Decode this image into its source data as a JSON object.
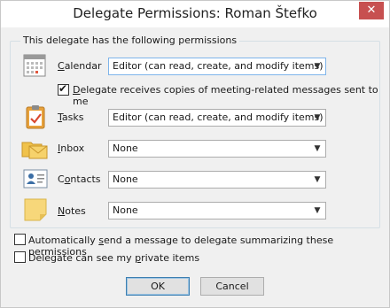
{
  "dialog": {
    "title": "Delegate Permissions: Roman Štefko",
    "close_glyph": "✕"
  },
  "group": {
    "legend": "This delegate has the following permissions"
  },
  "permissions": [
    {
      "label": "Calendar",
      "mnemonic": "C",
      "rest": "alendar",
      "icon": "calendar-icon",
      "value": "Editor (can read, create, and modify items)"
    },
    {
      "label": "Tasks",
      "mnemonic": "T",
      "rest": "asks",
      "icon": "tasks-clipboard-icon",
      "value": "Editor (can read, create, and modify items)"
    },
    {
      "label": "Inbox",
      "mnemonic": "I",
      "rest": "nbox",
      "icon": "inbox-envelope-icon",
      "value": "None"
    },
    {
      "label": "Contacts",
      "mnemonic": "o",
      "pre": "C",
      "rest": "ntacts",
      "icon": "contact-card-icon",
      "value": "None"
    },
    {
      "label": "Notes",
      "mnemonic": "N",
      "rest": "otes",
      "icon": "sticky-note-icon",
      "value": "None"
    }
  ],
  "meeting_copies": {
    "checked": true,
    "label_mnemonic": "D",
    "label_rest": "elegate receives copies of meeting-related messages sent to me"
  },
  "auto_send": {
    "checked": false,
    "pre": "Automatically ",
    "mnemonic": "s",
    "rest": "end a message to delegate summarizing these permissions"
  },
  "private_items": {
    "checked": false,
    "pre": "Delegate can see my ",
    "mnemonic": "p",
    "rest": "rivate items"
  },
  "buttons": {
    "ok": "OK",
    "cancel": "Cancel"
  },
  "colors": {
    "close_red": "#c75050",
    "focus_blue": "#7eb4ea",
    "note_yellow": "#f7d77a",
    "envelope_yellow": "#f6d26b",
    "clipboard_orange": "#e7a13b"
  }
}
